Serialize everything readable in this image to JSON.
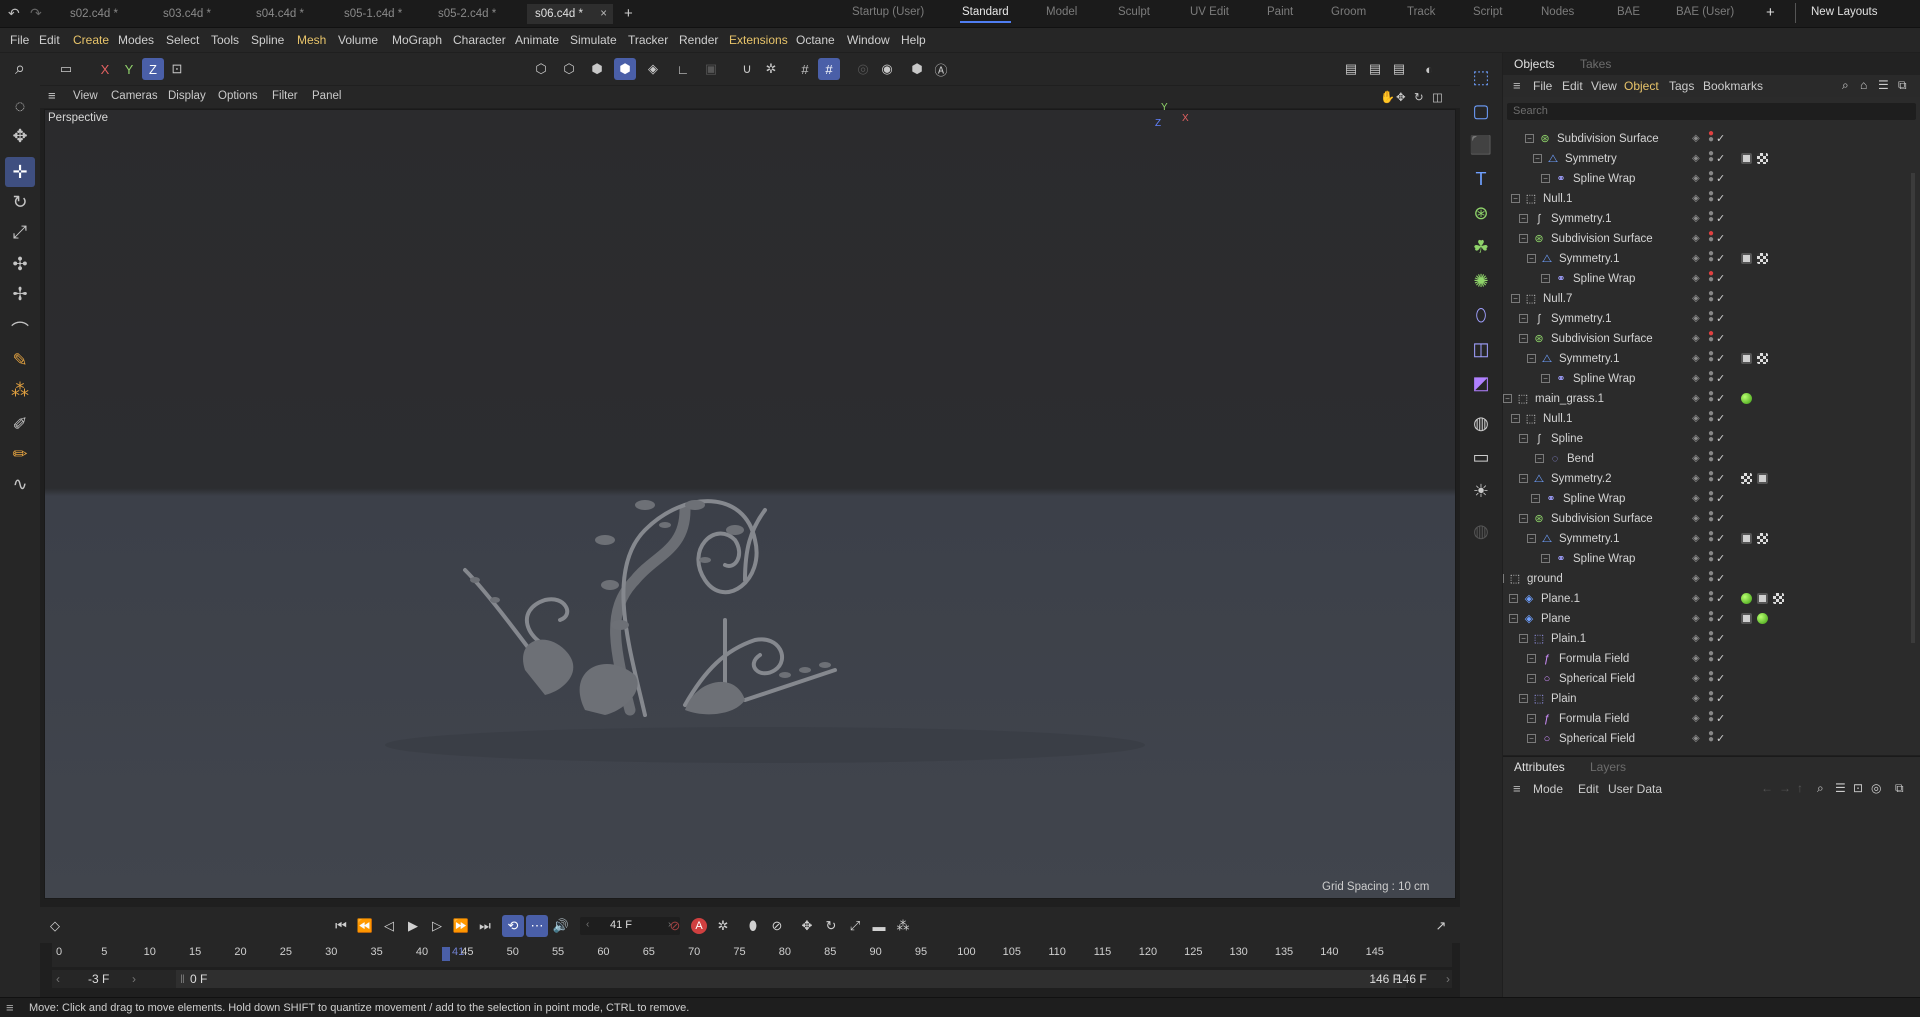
{
  "file_tabs": [
    {
      "label": "s02.c4d *"
    },
    {
      "label": "s03.c4d *"
    },
    {
      "label": "s04.c4d *"
    },
    {
      "label": "s05-1.c4d *"
    },
    {
      "label": "s05-2.c4d *"
    },
    {
      "label": "s06.c4d *",
      "active": true
    }
  ],
  "close_glyph": "×",
  "add_tab_glyph": "+",
  "layouts": [
    "Startup (User)",
    "Standard",
    "Model",
    "Sculpt",
    "UV Edit",
    "Paint",
    "Groom",
    "Track",
    "Script",
    "Nodes",
    "BAE",
    "BAE (User)"
  ],
  "current_layout": "Standard",
  "new_layouts_label": "New Layouts",
  "menu": [
    "File",
    "Edit",
    "Create",
    "Modes",
    "Select",
    "Tools",
    "Spline",
    "Mesh",
    "Volume",
    "MoGraph",
    "Character",
    "Animate",
    "Simulate",
    "Tracker",
    "Render",
    "Extensions",
    "Octane",
    "Window",
    "Help"
  ],
  "axis_buttons": {
    "x": "X",
    "y": "Y",
    "z": "Z"
  },
  "viewport_menu": [
    "View",
    "Cameras",
    "Display",
    "Options",
    "Filter",
    "Panel"
  ],
  "viewport": {
    "camera": "Perspective",
    "grid_spacing": "Grid Spacing : 10 cm"
  },
  "objects_panel": {
    "tabs": [
      "Objects",
      "Takes"
    ],
    "menu": [
      "File",
      "Edit",
      "View",
      "Object",
      "Tags",
      "Bookmarks"
    ],
    "search_placeholder": "Search",
    "rows": [
      {
        "name": "Subdivision Surface",
        "icon": "subdivision-surface-icon",
        "dot": "red"
      },
      {
        "name": "Symmetry",
        "icon": "symmetry-icon",
        "tags": [
          "phong",
          "checker"
        ]
      },
      {
        "name": "Spline Wrap",
        "icon": "spline-wrap-icon"
      },
      {
        "name": "Null.1",
        "icon": "null-icon"
      },
      {
        "name": "Symmetry.1",
        "icon": "spline-icon"
      },
      {
        "name": "Subdivision Surface",
        "icon": "subdivision-surface-icon",
        "dot": "red"
      },
      {
        "name": "Symmetry.1",
        "icon": "symmetry-icon",
        "tags": [
          "phong",
          "checker"
        ]
      },
      {
        "name": "Spline Wrap",
        "icon": "spline-wrap-icon",
        "dot": "red"
      },
      {
        "name": "Null.7",
        "icon": "null-icon"
      },
      {
        "name": "Symmetry.1",
        "icon": "spline-icon"
      },
      {
        "name": "Subdivision Surface",
        "icon": "subdivision-surface-icon",
        "dot": "red"
      },
      {
        "name": "Symmetry.1",
        "icon": "symmetry-icon",
        "tags": [
          "phong",
          "checker"
        ]
      },
      {
        "name": "Spline Wrap",
        "icon": "spline-wrap-icon"
      },
      {
        "name": "main_grass.1",
        "icon": "null-icon",
        "tags": [
          "green-ball"
        ]
      },
      {
        "name": "Null.1",
        "icon": "null-icon"
      },
      {
        "name": "Spline",
        "icon": "spline-icon"
      },
      {
        "name": "Bend",
        "icon": "bend-icon"
      },
      {
        "name": "Symmetry.2",
        "icon": "symmetry-icon",
        "tags": [
          "checker",
          "phong"
        ]
      },
      {
        "name": "Spline Wrap",
        "icon": "spline-wrap-icon"
      },
      {
        "name": "Subdivision Surface",
        "icon": "subdivision-surface-icon"
      },
      {
        "name": "Symmetry.1",
        "icon": "symmetry-icon",
        "tags": [
          "phong",
          "checker"
        ]
      },
      {
        "name": "Spline Wrap",
        "icon": "spline-wrap-icon"
      },
      {
        "name": "ground",
        "icon": "null-icon"
      },
      {
        "name": "Plane.1",
        "icon": "plane-icon",
        "tags": [
          "green-ball",
          "phong",
          "checker"
        ]
      },
      {
        "name": "Plane",
        "icon": "plane-icon",
        "tags": [
          "phong",
          "green-ball"
        ]
      },
      {
        "name": "Plain.1",
        "icon": "plain-icon"
      },
      {
        "name": "Formula Field",
        "icon": "formula-field-icon"
      },
      {
        "name": "Spherical Field",
        "icon": "spherical-field-icon"
      },
      {
        "name": "Plain",
        "icon": "plain-icon"
      },
      {
        "name": "Formula Field",
        "icon": "formula-field-icon"
      },
      {
        "name": "Spherical Field",
        "icon": "spherical-field-icon"
      }
    ]
  },
  "attributes_panel": {
    "tabs": [
      "Attributes",
      "Layers"
    ],
    "menu": [
      "Mode",
      "Edit",
      "User Data"
    ]
  },
  "timeline": {
    "current_frame": "41 F",
    "ticks": [
      "0",
      "5",
      "10",
      "15",
      "20",
      "25",
      "30",
      "35",
      "40",
      "45",
      "50",
      "55",
      "60",
      "65",
      "70",
      "75",
      "80",
      "85",
      "90",
      "95",
      "100",
      "105",
      "110",
      "115",
      "120",
      "125",
      "130",
      "135",
      "140",
      "145"
    ],
    "playhead_label": "41",
    "range_start": "-3 F",
    "preview_start": "0 F",
    "preview_end": "146 F",
    "range_end": "146 F",
    "auto_key_label": "A"
  },
  "status": "Move: Click and drag to move elements. Hold down SHIFT to quantize movement / add to the selection in point mode, CTRL to remove."
}
